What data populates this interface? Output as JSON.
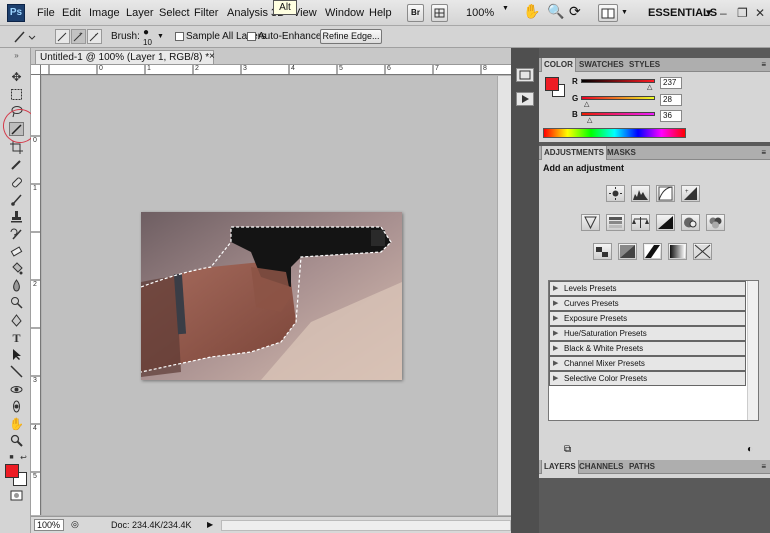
{
  "tooltip": "Alt",
  "menubar": {
    "logo": "Ps",
    "menus": [
      "File",
      "Edit",
      "Image",
      "Layer",
      "Select",
      "Filter",
      "Analysis",
      "3D",
      "View",
      "Window",
      "Help"
    ],
    "bridge_label": "Br",
    "zoom_level": "100%",
    "workspace": "ESSENTIALS",
    "workspace_arrow": "▾",
    "window_buttons": [
      "–",
      "❐",
      "✕"
    ]
  },
  "options": {
    "brush_label": "Brush:",
    "brush_size": "10",
    "sample_all_layers": "Sample All Layers",
    "auto_enhance": "Auto-Enhance",
    "refine_edge": "Refine Edge..."
  },
  "document": {
    "tab_title": "Untitled-1 @ 100% (Layer 1, RGB/8) *",
    "close": "×",
    "zoom": "100%",
    "doc_size": "Doc: 234.4K/234.4K",
    "ruler_top": [
      "0",
      "1",
      "2",
      "3",
      "4",
      "5",
      "6",
      "7",
      "8"
    ],
    "ruler_left": [
      "0",
      "1",
      "2",
      "3",
      "4",
      "5"
    ]
  },
  "color_panel": {
    "tabs": [
      "COLOR",
      "SWATCHES",
      "STYLES"
    ],
    "r_label": "R",
    "r_value": "237",
    "g_label": "G",
    "g_value": "28",
    "b_label": "B",
    "b_value": "36",
    "foreground": "#ed1c24"
  },
  "adjustments_panel": {
    "tabs": [
      "ADJUSTMENTS",
      "MASKS"
    ],
    "heading": "Add an adjustment",
    "presets": [
      "Levels Presets",
      "Curves Presets",
      "Exposure Presets",
      "Hue/Saturation Presets",
      "Black & White Presets",
      "Channel Mixer Presets",
      "Selective Color Presets"
    ]
  },
  "layers_panel": {
    "tabs": [
      "LAYERS",
      "CHANNELS",
      "PATHS"
    ]
  }
}
